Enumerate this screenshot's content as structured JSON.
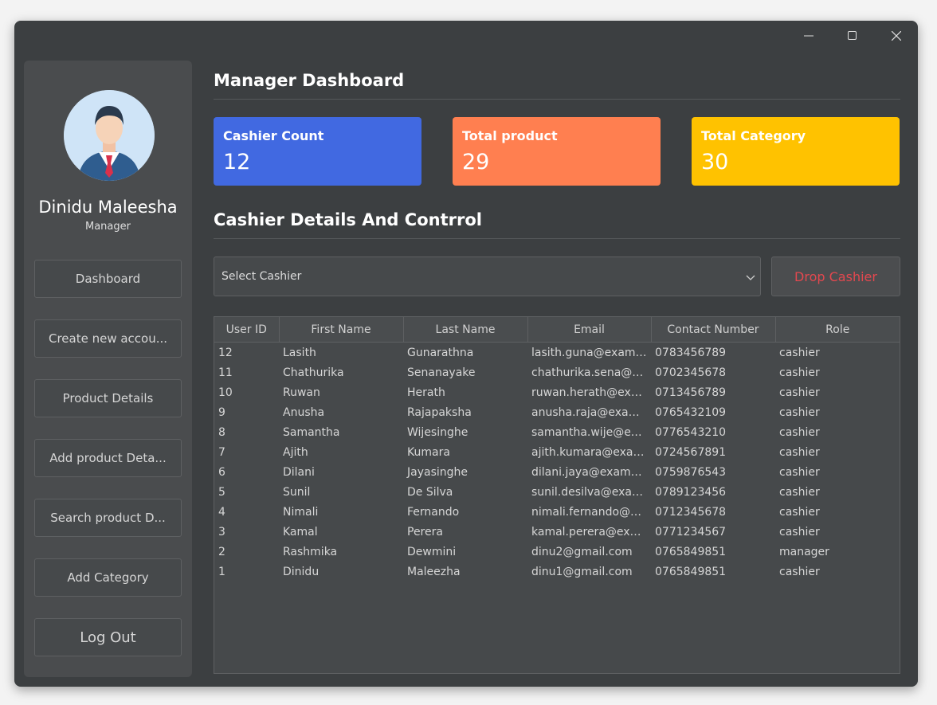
{
  "window": {
    "controls": [
      "minimize-icon",
      "maximize-icon",
      "close-icon"
    ]
  },
  "profile": {
    "name": "Dinidu Maleesha",
    "role": "Manager"
  },
  "nav": {
    "dashboard": "Dashboard",
    "create_account": "Create new accou...",
    "product_details": "Product Details",
    "add_product": "Add product Deta...",
    "search_product": "Search product D...",
    "add_category": "Add Category",
    "logout": "Log Out"
  },
  "dashboard": {
    "title": "Manager Dashboard",
    "cards": [
      {
        "title": "Cashier Count",
        "value": "12",
        "color": "#4169e1"
      },
      {
        "title": "Total product",
        "value": "29",
        "color": "#ff7f50"
      },
      {
        "title": "Total Category",
        "value": "30",
        "color": "#ffc200"
      }
    ]
  },
  "cashier_section": {
    "title": "Cashier Details And Contrrol",
    "select_placeholder": "Select Cashier",
    "drop_button": "Drop Cashier",
    "drop_color": "#e3484f"
  },
  "table": {
    "columns": [
      "User ID",
      "First Name",
      "Last Name",
      "Email",
      "Contact Number",
      "Role"
    ],
    "rows": [
      [
        "12",
        "Lasith",
        "Gunarathna",
        "lasith.guna@example...",
        "0783456789",
        "cashier"
      ],
      [
        "11",
        "Chathurika",
        "Senanayake",
        "chathurika.sena@exa...",
        "0702345678",
        "cashier"
      ],
      [
        "10",
        "Ruwan",
        "Herath",
        "ruwan.herath@examp...",
        "0713456789",
        "cashier"
      ],
      [
        "9",
        "Anusha",
        "Rajapaksha",
        "anusha.raja@example...",
        "0765432109",
        "cashier"
      ],
      [
        "8",
        "Samantha",
        "Wijesinghe",
        "samantha.wije@exam...",
        "0776543210",
        "cashier"
      ],
      [
        "7",
        "Ajith",
        "Kumara",
        "ajith.kumara@exampl...",
        "0724567891",
        "cashier"
      ],
      [
        "6",
        "Dilani",
        "Jayasinghe",
        "dilani.jaya@example.l...",
        "0759876543",
        "cashier"
      ],
      [
        "5",
        "Sunil",
        "De Silva",
        "sunil.desilva@exampl...",
        "0789123456",
        "cashier"
      ],
      [
        "4",
        "Nimali",
        "Fernando",
        "nimali.fernando@exa...",
        "0712345678",
        "cashier"
      ],
      [
        "3",
        "Kamal",
        "Perera",
        "kamal.perera@exam...",
        "0771234567",
        "cashier"
      ],
      [
        "2",
        "Rashmika",
        "Dewmini",
        "dinu2@gmail.com",
        "0765849851",
        "manager"
      ],
      [
        "1",
        "Dinidu",
        "Maleezha",
        "dinu1@gmail.com",
        "0765849851",
        "cashier"
      ]
    ]
  }
}
